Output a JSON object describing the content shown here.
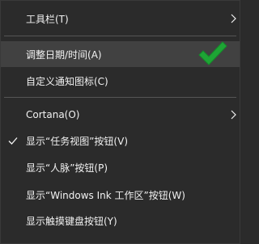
{
  "menu": {
    "items": [
      {
        "label": "工具栏(T)",
        "submenu": true
      },
      {
        "label": "调整日期/时间(A)",
        "highlighted": true
      },
      {
        "label": "自定义通知图标(C)"
      },
      {
        "label": "Cortana(O)",
        "submenu": true
      },
      {
        "label": "显示“任务视图”按钮(V)",
        "checked": true
      },
      {
        "label": "显示“人脉”按钮(P)"
      },
      {
        "label": "显示“Windows Ink 工作区”按钮(W)"
      },
      {
        "label": "显示触摸键盘按钮(Y)"
      }
    ]
  },
  "colors": {
    "menu_background": "#2b2b2b",
    "hover_background": "#414141",
    "text": "#f2f2f2",
    "separator": "#555555",
    "annotation_check": "#1ea535"
  },
  "annotation": {
    "icon": "green-checkmark-icon"
  }
}
